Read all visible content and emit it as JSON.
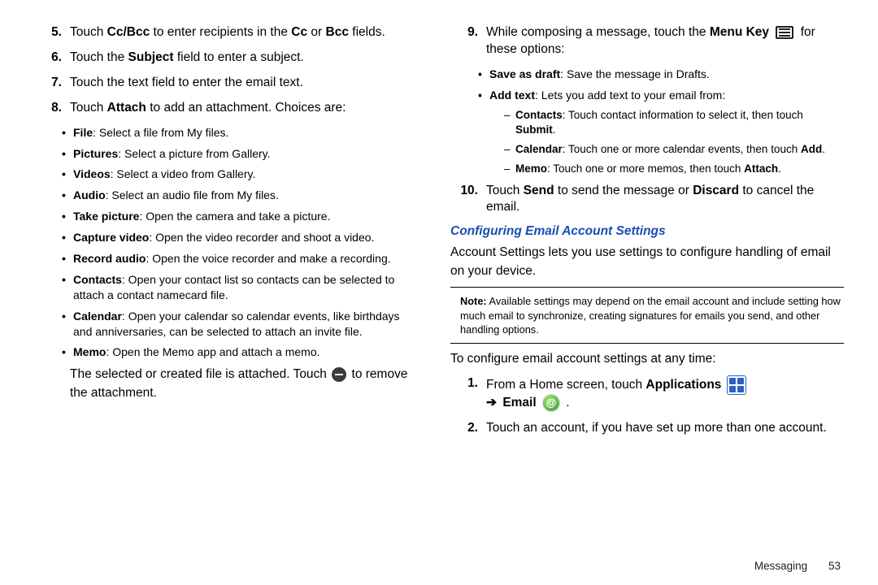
{
  "left": {
    "items": {
      "n5": {
        "num": "5.",
        "pre": "Touch ",
        "b1": "Cc/Bcc",
        "mid": " to enter recipients in the ",
        "b2": "Cc",
        "mid2": " or ",
        "b3": "Bcc",
        "post": " fields."
      },
      "n6": {
        "num": "6.",
        "pre": "Touch the ",
        "b": "Subject",
        "post": " field to enter a subject."
      },
      "n7": {
        "num": "7.",
        "text": "Touch the text field to enter the email text."
      },
      "n8": {
        "num": "8.",
        "pre": "Touch ",
        "b": "Attach",
        "post": " to add an attachment. Choices are:"
      }
    },
    "bullets": {
      "file": {
        "b": "File",
        "t": ": Select a file from My files."
      },
      "pictures": {
        "b": "Pictures",
        "t": ": Select a picture from Gallery."
      },
      "videos": {
        "b": "Videos",
        "t": ": Select a video from Gallery."
      },
      "audio": {
        "b": "Audio",
        "t": ": Select an audio file from My files."
      },
      "takepic": {
        "b": "Take picture",
        "t": ": Open the camera and take a picture."
      },
      "capvid": {
        "b": "Capture video",
        "t": ": Open the video recorder and shoot a video."
      },
      "recaudio": {
        "b": "Record audio",
        "t": ": Open the voice recorder and make a recording."
      },
      "contacts": {
        "b": "Contacts",
        "t": ": Open your contact list so contacts can be selected to attach a contact namecard file."
      },
      "calendar": {
        "b": "Calendar",
        "t": ": Open your calendar so calendar events, like birthdays and anniversaries, can be selected to attach an invite file."
      },
      "memo": {
        "b": "Memo",
        "t": ": Open the Memo app and attach a memo."
      }
    },
    "after": {
      "pre": "The selected or created file is attached. Touch ",
      "post": " to remove the attachment."
    }
  },
  "right": {
    "n9": {
      "num": "9.",
      "pre": "While composing a message, touch the ",
      "b": "Menu Key",
      "post": " for these options:"
    },
    "bullets": {
      "savedraft": {
        "b": "Save as draft",
        "t": ": Save the message in Drafts."
      },
      "addtext": {
        "b": "Add text",
        "t": ": Lets you add text to your email from:"
      }
    },
    "dashes": {
      "contacts": {
        "b": "Contacts",
        "t": ": Touch contact information to select it, then touch ",
        "b2": "Submit",
        "t2": "."
      },
      "calendar": {
        "b": "Calendar",
        "t": ": Touch one or more calendar events, then touch ",
        "b2": "Add",
        "t2": "."
      },
      "memo": {
        "b": "Memo",
        "t": ": Touch one or more memos, then touch ",
        "b2": "Attach",
        "t2": "."
      }
    },
    "n10": {
      "num": "10.",
      "pre": "Touch ",
      "b1": "Send",
      "mid": " to send the message or ",
      "b2": "Discard",
      "post": " to cancel the email."
    },
    "heading": "Configuring Email Account Settings",
    "intro": "Account Settings lets you use settings to configure handling of email on your device.",
    "note": {
      "b": "Note:",
      "t": " Available settings may depend on the email account and include setting how much email to synchronize, creating signatures for emails you send, and other handling options."
    },
    "lead": "To configure email account settings at any time:",
    "s1": {
      "num": "1.",
      "pre": "From a Home screen, touch ",
      "b1": "Applications",
      "arrow": "➔",
      "b2": "Email",
      "post": " ."
    },
    "s2": {
      "num": "2.",
      "text": "Touch an account, if you have set up more than one account."
    }
  },
  "footer": {
    "section": "Messaging",
    "page": "53"
  },
  "icons": {
    "email_glyph": "@"
  }
}
